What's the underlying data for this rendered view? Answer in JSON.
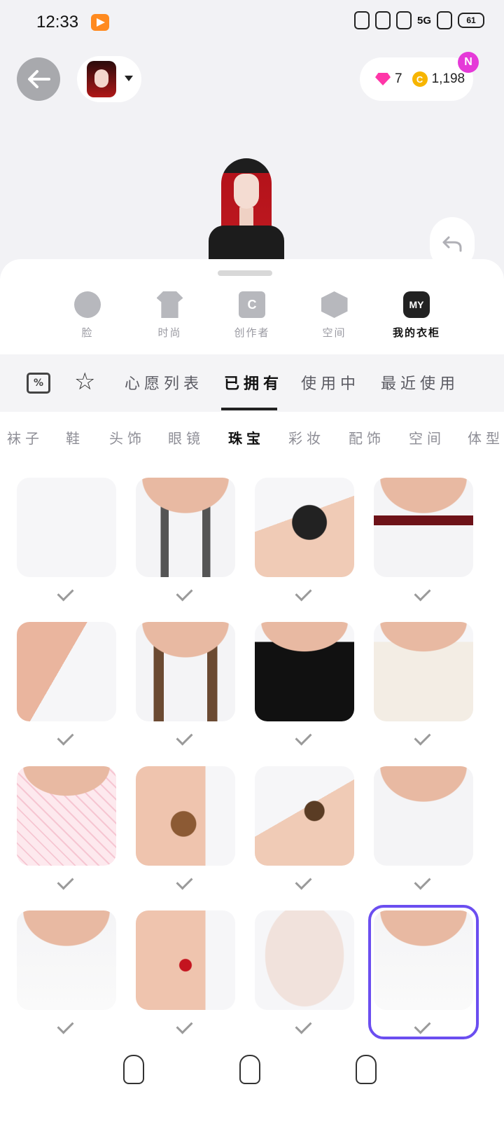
{
  "status_bar": {
    "time": "12:33",
    "network": "5G",
    "battery": "61"
  },
  "header": {
    "gems": "7",
    "coins": "1,198",
    "new_badge": "N"
  },
  "categories": [
    {
      "label": "脸",
      "icon": "face-icon",
      "glyph": ""
    },
    {
      "label": "时尚",
      "icon": "shirt-icon",
      "glyph": ""
    },
    {
      "label": "创作者",
      "icon": "creator-bag-icon",
      "glyph": "C"
    },
    {
      "label": "空间",
      "icon": "cube-icon",
      "glyph": ""
    },
    {
      "label": "我的衣柜",
      "icon": "my-wardrobe-icon",
      "glyph": "MY"
    }
  ],
  "tabs": {
    "ticket_glyph": "%",
    "wishlist": "心愿列表",
    "owned": "已拥有",
    "in_use": "使用中",
    "recent": "最近使用"
  },
  "subcategories": [
    "袜子",
    "鞋",
    "头饰",
    "眼镜",
    "珠宝",
    "彩妆",
    "配饰",
    "空间",
    "体型"
  ],
  "active_subcategory": "珠宝",
  "items": [
    "punk-layered-necklace",
    "heart-pendant-scarf",
    "lace-fingerless-glove",
    "cross-velvet-choker",
    "heart-chain-nose-piercing",
    "brown-scarf-heart-necklace",
    "black-fur-scarf",
    "white-fur-scarf",
    "pink-plaid-fur-scarf",
    "teddy-bear-earring",
    "leopard-wrist-cuff",
    "beaded-double-necklace",
    "pearl-bow-necklace",
    "red-drop-earring",
    "face-base",
    "silver-bow-necklace"
  ],
  "colors": {
    "accent": "#6b4ef0",
    "badge": "#e53ad8",
    "gem": "#ff36a8",
    "coin": "#f7b500"
  }
}
